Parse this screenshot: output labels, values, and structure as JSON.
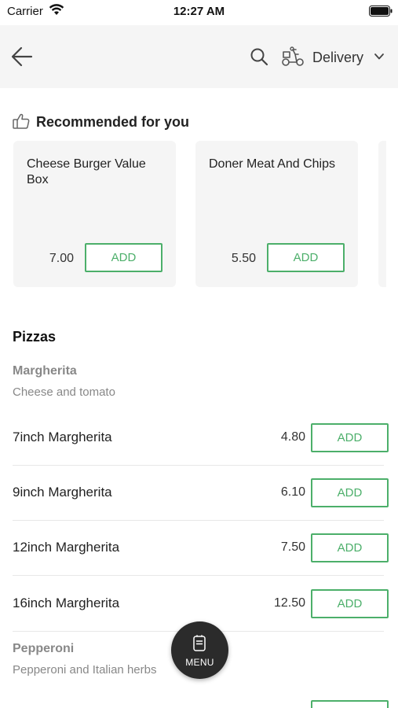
{
  "status_bar": {
    "carrier": "Carrier",
    "time": "12:27 AM"
  },
  "nav": {
    "delivery_label": "Delivery"
  },
  "colors": {
    "accent_green": "#4caf6a",
    "nav_background": "#f5f5f5",
    "fab_background": "#2b2b2b"
  },
  "recommended": {
    "title": "Recommended for you",
    "items": [
      {
        "name": "Cheese Burger Value Box",
        "price": "7.00",
        "add_label": "ADD"
      },
      {
        "name": "Doner Meat And Chips",
        "price": "5.50",
        "add_label": "ADD"
      }
    ]
  },
  "menu": {
    "section_title": "Pizzas",
    "groups": [
      {
        "name": "Margherita",
        "description": "Cheese and tomato",
        "items": [
          {
            "name": "7inch Margherita",
            "price": "4.80",
            "add_label": "ADD"
          },
          {
            "name": "9inch Margherita",
            "price": "6.10",
            "add_label": "ADD"
          },
          {
            "name": "12inch Margherita",
            "price": "7.50",
            "add_label": "ADD"
          },
          {
            "name": "16inch Margherita",
            "price": "12.50",
            "add_label": "ADD"
          }
        ]
      },
      {
        "name": "Pepperoni",
        "description": "Pepperoni and Italian herbs",
        "items": []
      }
    ]
  },
  "fab": {
    "label": "MENU"
  },
  "icons": [
    "wifi-icon",
    "battery-icon",
    "back-icon",
    "search-icon",
    "delivery-scooter-icon",
    "chevron-down-icon",
    "thumbs-up-icon",
    "menu-book-icon"
  ]
}
